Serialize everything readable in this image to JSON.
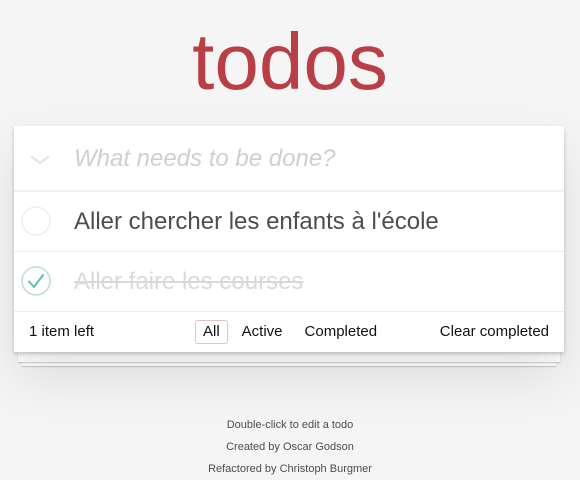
{
  "app": {
    "title": "todos"
  },
  "header": {
    "placeholder": "What needs to be done?",
    "toggle_all_icon": "chevron-down-icon"
  },
  "todos": [
    {
      "label": "Aller chercher les enfants à l'école",
      "completed": false
    },
    {
      "label": "Aller faire les courses",
      "completed": true
    }
  ],
  "footer": {
    "count": "1 item left",
    "filters": [
      "All",
      "Active",
      "Completed"
    ],
    "selected_filter": "All",
    "clear_completed": "Clear completed"
  },
  "info": {
    "line1": "Double-click to edit a todo",
    "line2": "Created by Oscar Godson",
    "line3": "Refactored by Christoph Burgmer"
  },
  "colors": {
    "title": "#b83f45",
    "check_complete": "#5dc2af",
    "selected_filter_border": "#e3c2c2"
  }
}
